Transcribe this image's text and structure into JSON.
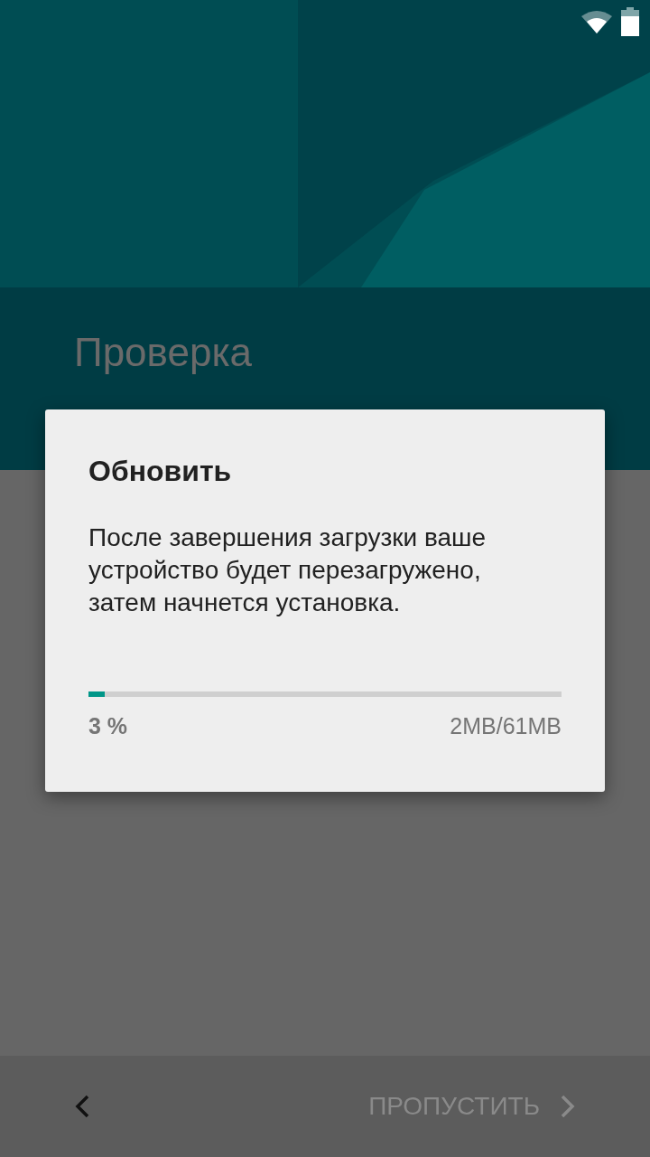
{
  "page": {
    "title": "Проверка"
  },
  "dialog": {
    "title": "Обновить",
    "message": "После завершения загрузки ваше устройство будет перезагружено, затем начнется установка.",
    "progress": {
      "level": 0.035,
      "percent": "3 %",
      "size": "2MB/61MB"
    }
  },
  "bottom_bar": {
    "skip": {
      "label": "ПРОПУСТИТЬ",
      "disabled": true
    }
  }
}
